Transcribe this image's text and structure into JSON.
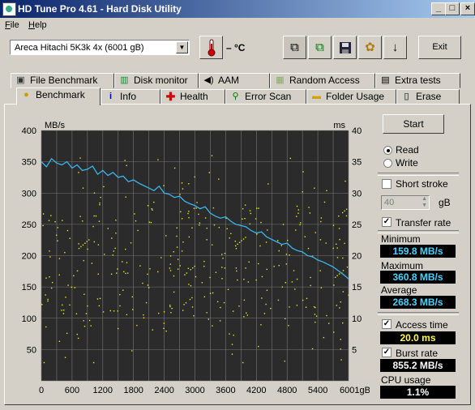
{
  "window": {
    "title": "HD Tune Pro 4.61 - Hard Disk Utility",
    "controls": [
      "_",
      "□",
      "×"
    ]
  },
  "menu": [
    {
      "label": "File"
    },
    {
      "label": "Help"
    }
  ],
  "toolbar": {
    "drive": "Areca   Hitachi 5K3k 4x  (6001 gB)",
    "temperature": "– °C",
    "exit_label": "Exit",
    "icons": [
      "copy-icon",
      "copy-info-icon",
      "save-icon",
      "options-icon",
      "download-icon"
    ]
  },
  "tabs": {
    "row1": [
      {
        "label": "File Benchmark",
        "icon": "file-benchmark-icon"
      },
      {
        "label": "Disk monitor",
        "icon": "disk-monitor-icon"
      },
      {
        "label": "AAM",
        "icon": "speaker-icon"
      },
      {
        "label": "Random Access",
        "icon": "random-access-icon"
      },
      {
        "label": "Extra tests",
        "icon": "extra-tests-icon"
      }
    ],
    "row2": [
      {
        "label": "Benchmark",
        "icon": "benchmark-icon"
      },
      {
        "label": "Info",
        "icon": "info-icon"
      },
      {
        "label": "Health",
        "icon": "health-icon"
      },
      {
        "label": "Error Scan",
        "icon": "magnifier-icon"
      },
      {
        "label": "Folder Usage",
        "icon": "folder-icon"
      },
      {
        "label": "Erase",
        "icon": "trash-icon"
      }
    ],
    "active": "Benchmark"
  },
  "controls": {
    "start_label": "Start",
    "read_label": "Read",
    "read_selected": true,
    "write_label": "Write",
    "write_selected": false,
    "short_stroke_label": "Short stroke",
    "short_stroke_checked": false,
    "short_stroke_value": "40",
    "short_stroke_unit": "gB",
    "transfer_rate_label": "Transfer rate",
    "transfer_rate_checked": true,
    "access_time_label": "Access time",
    "access_time_checked": true,
    "burst_rate_label": "Burst rate",
    "burst_rate_checked": true
  },
  "results": {
    "minimum_label": "Minimum",
    "minimum": "159.8 MB/s",
    "maximum_label": "Maximum",
    "maximum": "360.8 MB/s",
    "average_label": "Average",
    "average": "268.3 MB/s",
    "access_time": "20.0 ms",
    "burst_rate": "855.2 MB/s",
    "cpu_label": "CPU usage",
    "cpu": "1.1%"
  },
  "colors": {
    "transfer_line": "#38b6f0",
    "access_dots": "#e8e820",
    "plot_bg": "#2b2b2b",
    "value_text": "#4ad2ff"
  },
  "chart_data": {
    "type": "line",
    "y_left_unit": "MB/s",
    "y_right_unit": "ms",
    "ylim_left": [
      0,
      400
    ],
    "ylim_right": [
      0,
      40
    ],
    "xlim": [
      0,
      6001
    ],
    "y_left_ticks": [
      "400",
      "350",
      "300",
      "250",
      "200",
      "150",
      "100",
      "50"
    ],
    "y_right_ticks": [
      "40",
      "35",
      "30",
      "25",
      "20",
      "15",
      "10",
      "5"
    ],
    "x_ticks": [
      "0",
      "600",
      "1200",
      "1800",
      "2400",
      "3000",
      "3600",
      "4200",
      "4800",
      "5400",
      "6001gB"
    ],
    "series": [
      {
        "x": [
          0,
          100,
          200,
          300,
          400,
          500,
          600,
          700,
          800,
          900,
          1000,
          1100,
          1200,
          1300,
          1400,
          1500,
          1600,
          1700,
          1800,
          1900,
          2000,
          2100,
          2200,
          2300,
          2400,
          2500,
          2600,
          2700,
          2800,
          2900,
          3000,
          3100,
          3200,
          3300,
          3400,
          3500,
          3600,
          3700,
          3800,
          3900,
          4000,
          4100,
          4200,
          4300,
          4400,
          4500,
          4600,
          4700,
          4800,
          4900,
          5000,
          5100,
          5200,
          5300,
          5400,
          5500,
          5600,
          5700,
          5800,
          5900,
          6001
        ],
        "values": [
          350,
          342,
          355,
          348,
          345,
          350,
          340,
          345,
          336,
          338,
          343,
          330,
          336,
          328,
          333,
          325,
          327,
          318,
          321,
          316,
          312,
          308,
          304,
          311,
          300,
          298,
          293,
          295,
          287,
          283,
          280,
          275,
          278,
          268,
          263,
          260,
          262,
          255,
          250,
          248,
          246,
          240,
          236,
          238,
          230,
          226,
          222,
          218,
          220,
          212,
          208,
          206,
          200,
          198,
          193,
          190,
          186,
          182,
          176,
          170,
          163
        ]
      }
    ],
    "access_time_ms_avg": 20.0
  }
}
